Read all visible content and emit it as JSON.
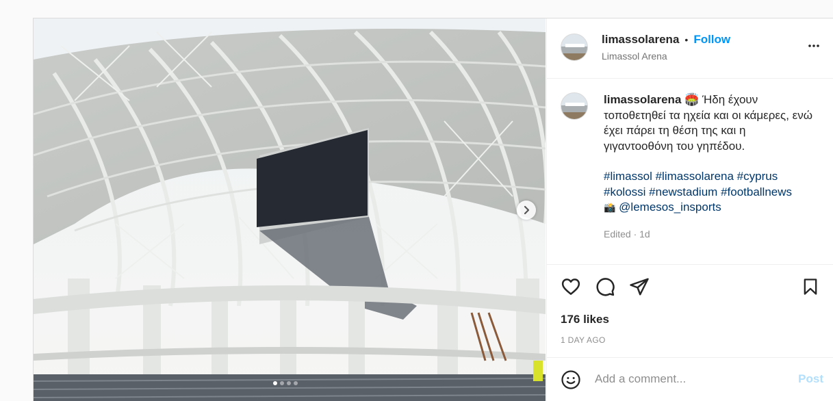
{
  "post": {
    "username": "limassolarena",
    "follow_label": "Follow",
    "bullet": "•",
    "location": "Limassol Arena",
    "more_icon": "more-horizontal-icon",
    "caption": {
      "emoji": "🏟️",
      "text": "Ήδη έχουν τοποθετηθεί τα ηχεία και οι κάμερες, ενώ έχει πάρει τη θέση της και η γιγαντοοθόνη του γηπέδου.",
      "hashtags": [
        "#limassol",
        "#limassolarena",
        "#cyprus",
        "#kolossi",
        "#newstadium",
        "#footballnews"
      ],
      "credit_emoji": "📸",
      "credit": "@lemesos_insports"
    },
    "edited": "Edited · 1d",
    "likes": "176 likes",
    "time": "1 DAY AGO",
    "carousel": {
      "slide_count": 4,
      "active_index": 0
    },
    "add_comment_placeholder": "Add a comment...",
    "post_label": "Post"
  },
  "colors": {
    "accent": "#0095f6",
    "hashtag": "#00376b",
    "muted": "#8e8e8e",
    "post_disabled": "#b2dffc"
  }
}
